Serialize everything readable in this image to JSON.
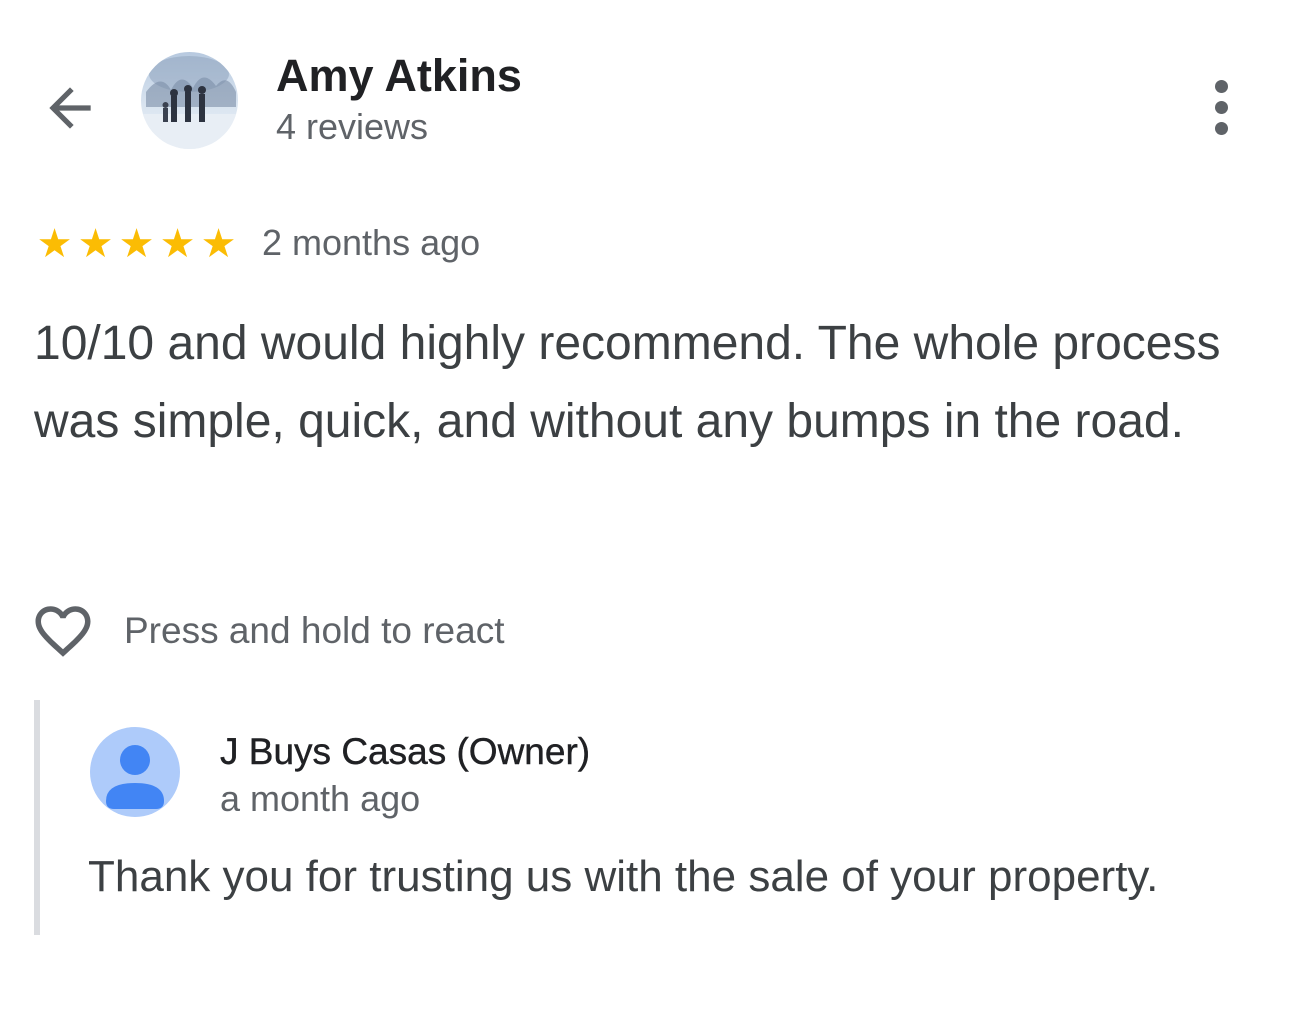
{
  "header": {
    "back_icon": "arrow-left-icon",
    "reviewer_name": "Amy Atkins",
    "reviewer_review_count": "4 reviews",
    "more_icon": "more-vertical-icon"
  },
  "review": {
    "rating": 5,
    "rating_max": 5,
    "star_glyph": "★",
    "star_color": "#fbbc04",
    "time_ago": "2 months ago",
    "text": "10/10 and would highly recommend. The whole process was simple, quick, and without any bumps in the road."
  },
  "reaction": {
    "icon": "heart-outline-icon",
    "label": "Press and hold to react"
  },
  "owner_reply": {
    "avatar_icon": "person-avatar-icon",
    "avatar_color": "#aecbfa",
    "name": "J Buys Casas (Owner)",
    "time_ago": "a month ago",
    "text": "Thank you for trusting us with the sale of your property."
  }
}
